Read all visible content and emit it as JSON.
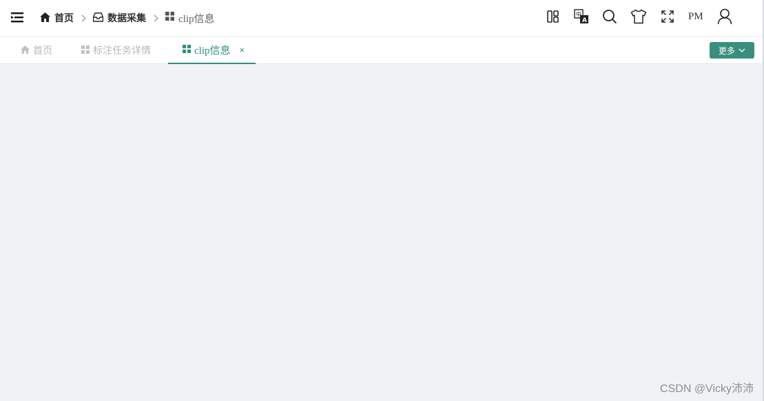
{
  "breadcrumb": {
    "items": [
      {
        "label": "首页",
        "icon": "home-icon"
      },
      {
        "label": "数据采集",
        "icon": "inbox-icon"
      },
      {
        "label": "clip信息",
        "icon": "grid-icon"
      }
    ]
  },
  "toolbar": {
    "pm_label": "PM",
    "icons": [
      "layout-icon",
      "translate-icon",
      "search-icon",
      "theme-shirt-icon",
      "fullscreen-icon",
      "user-icon"
    ]
  },
  "tabs": [
    {
      "label": "首页",
      "icon": "home-icon",
      "active": false
    },
    {
      "label": "标注任务详情",
      "icon": "grid-icon",
      "active": false
    },
    {
      "label": "clip信息",
      "icon": "grid-icon",
      "active": true,
      "close": "×"
    }
  ],
  "more_button": {
    "label": "更多"
  },
  "watermark": "CSDN @Vicky沛沛",
  "colors": {
    "accent": "#2f8f7d",
    "button": "#3a8e7d",
    "background": "#f0f2f5"
  }
}
